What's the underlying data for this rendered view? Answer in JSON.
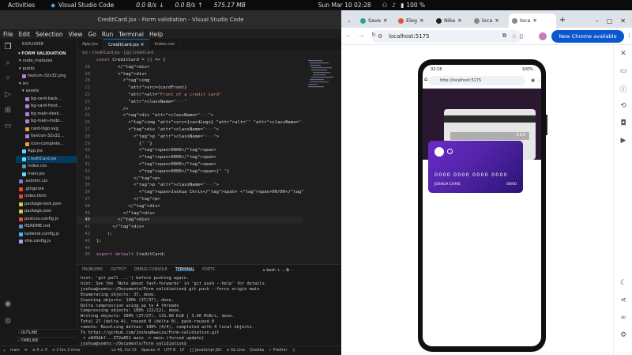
{
  "topbar": {
    "activities": "Activities",
    "app": "Visual Studio Code",
    "net_down": "0.0 B/s",
    "net_up": "0.0 B/s",
    "mem": "575.17 MB",
    "clock": "Sun Mar 10  02:28",
    "battery": "100 %"
  },
  "vscode": {
    "title": "CreditCard.jsx - Form validiation - Visual Studio Code",
    "menu": [
      "File",
      "Edit",
      "Selection",
      "View",
      "Go",
      "Run",
      "Terminal",
      "Help"
    ],
    "explorer_header": "EXPLORER",
    "project": "FORM VALIDIATION",
    "tree": [
      {
        "name": "node_modules",
        "kind": "folder",
        "indent": 1
      },
      {
        "name": "public",
        "kind": "folder",
        "indent": 1
      },
      {
        "name": "favicon-32x32.png",
        "kind": "file",
        "indent": 2,
        "color": "#b180d7"
      },
      {
        "name": "src",
        "kind": "folder",
        "indent": 1
      },
      {
        "name": "assets",
        "kind": "folder",
        "indent": 2
      },
      {
        "name": "bg-card-back...",
        "kind": "file",
        "indent": 3,
        "color": "#b180d7"
      },
      {
        "name": "bg-card-front...",
        "kind": "file",
        "indent": 3,
        "color": "#b180d7"
      },
      {
        "name": "bg-main-desk...",
        "kind": "file",
        "indent": 3,
        "color": "#b180d7"
      },
      {
        "name": "bg-main-mobi...",
        "kind": "file",
        "indent": 3,
        "color": "#b180d7"
      },
      {
        "name": "card-logo.svg",
        "kind": "file",
        "indent": 3,
        "color": "#e5a23c"
      },
      {
        "name": "favicon-32x32...",
        "kind": "file",
        "indent": 3,
        "color": "#b180d7"
      },
      {
        "name": "icon-complete...",
        "kind": "file",
        "indent": 3,
        "color": "#e5a23c"
      },
      {
        "name": "App.jsx",
        "kind": "file",
        "indent": 2,
        "color": "#61dafb"
      },
      {
        "name": "CreditCard.jsx",
        "kind": "file",
        "indent": 2,
        "color": "#61dafb",
        "selected": true
      },
      {
        "name": "index.css",
        "kind": "file",
        "indent": 2,
        "color": "#519aba"
      },
      {
        "name": "main.jsx",
        "kind": "file",
        "indent": 2,
        "color": "#61dafb"
      },
      {
        "name": ".eslintrc.cjs",
        "kind": "file",
        "indent": 1,
        "color": "#8a6fdc"
      },
      {
        "name": ".gitignore",
        "kind": "file",
        "indent": 1,
        "color": "#e44d26"
      },
      {
        "name": "index.html",
        "kind": "file",
        "indent": 1,
        "color": "#e44d26"
      },
      {
        "name": "package-lock.json",
        "kind": "file",
        "indent": 1,
        "color": "#cbcb41"
      },
      {
        "name": "package.json",
        "kind": "file",
        "indent": 1,
        "color": "#cbcb41"
      },
      {
        "name": "postcss.config.js",
        "kind": "file",
        "indent": 1,
        "color": "#e44d26"
      },
      {
        "name": "README.md",
        "kind": "file",
        "indent": 1,
        "color": "#519aba"
      },
      {
        "name": "tailwind.config.js",
        "kind": "file",
        "indent": 1,
        "color": "#38bdf8"
      },
      {
        "name": "vite.config.js",
        "kind": "file",
        "indent": 1,
        "color": "#bd93f9"
      }
    ],
    "outline": "OUTLINE",
    "timeline": "TIMELINE",
    "tabs": [
      {
        "label": "App.jsx",
        "active": false
      },
      {
        "label": "CreditCard.jsx",
        "active": true
      },
      {
        "label": "index.css",
        "active": false
      }
    ],
    "breadcrumb": "src › CreditCard.jsx › [@] CreditCard",
    "code": [
      {
        "n": "",
        "t": "const CreditCard = () => {"
      },
      {
        "n": "18",
        "t": "        </div>"
      },
      {
        "n": "19",
        "t": "        <div>"
      },
      {
        "n": "20",
        "t": "          <img"
      },
      {
        "n": "21",
        "t": "            src={cardFront}"
      },
      {
        "n": "22",
        "t": "            alt=\"Front of a credit card\""
      },
      {
        "n": "23",
        "t": "            className=\"···\""
      },
      {
        "n": "24",
        "t": "          />"
      },
      {
        "n": "25",
        "t": "          <div className=\"···\">"
      },
      {
        "n": "26",
        "t": "            <img src={cardLogo} alt=\"\" className=\"···\" />"
      },
      {
        "n": "27",
        "t": "            <div className=\"···\">"
      },
      {
        "n": "28",
        "t": "              <p className=\"···\">"
      },
      {
        "n": "29",
        "t": "                {\" \"}"
      },
      {
        "n": "30",
        "t": "                <span>0000</span>"
      },
      {
        "n": "31",
        "t": "                <span>0000</span>"
      },
      {
        "n": "32",
        "t": "                <span>0000</span>"
      },
      {
        "n": "33",
        "t": "                <span>0000</span>{\" \"}"
      },
      {
        "n": "34",
        "t": "              </p>"
      },
      {
        "n": "35",
        "t": "              <p className=\"···\">"
      },
      {
        "n": "36",
        "t": "                <span>Joshua Chris</span> <span>00/00</span>"
      },
      {
        "n": "37",
        "t": "              </p>"
      },
      {
        "n": "38",
        "t": "            </div>"
      },
      {
        "n": "39",
        "t": "          </div>"
      },
      {
        "n": "40",
        "t": "        </div>"
      },
      {
        "n": "41",
        "t": "      </div>"
      },
      {
        "n": "42",
        "t": "    );"
      },
      {
        "n": "43",
        "t": "};"
      },
      {
        "n": "44",
        "t": ""
      },
      {
        "n": "45",
        "t": "export default CreditCard;"
      }
    ],
    "current_line": "40",
    "panel_tabs": [
      "PROBLEMS",
      "OUTPUT",
      "DEBUG CONSOLE",
      "TERMINAL",
      "PORTS"
    ],
    "active_panel": "TERMINAL",
    "shell": "bash",
    "terminal": [
      "hint: 'git pull ...') before pushing again.",
      "hint: See the 'Note about fast-forwards' in 'git push --help' for details.",
      "joshua@somto:~/Documents/Form validiation$ git push --force origin main",
      "Enumerating objects: 37, done.",
      "Counting objects: 100% (37/37), done.",
      "Delta compression using up to 4 threads",
      "Compressing objects: 100% (22/22), done.",
      "Writing objects: 100% (27/27), 131.68 KiB | 3.66 MiB/s, done.",
      "Total 27 (delta 4), reused 0 (delta 0), pack-reused 0",
      "remote: Resolving deltas: 100% (4/4), completed with 4 local objects.",
      "To https://github.com/JoshuaNwaizu/Form-validiation.git",
      " + e043dbf...372a851 main -> main (forced update)",
      "joshua@somto:~/Documents/Form validiation$ "
    ],
    "status": {
      "branch": "main",
      "sync": "⟳",
      "problems": "⊗ 0 ⚠ 0",
      "time": "⊙ 2 hrs 3 mins",
      "position": "Ln 40, Col 13",
      "spaces": "Spaces: 4",
      "encoding": "UTF-8",
      "eol": "LF",
      "lang": "{} JavaScript JSX",
      "golive": "⊙ Go Live",
      "quokka": "Quokka",
      "prettier": "✓ Prettier"
    }
  },
  "chrome": {
    "tabs": [
      {
        "label": "Save",
        "color": "#2aa198"
      },
      {
        "label": "Eleg",
        "color": "#e5533d"
      },
      {
        "label": "Nike",
        "color": "#222222"
      },
      {
        "label": "loca",
        "color": "#888888"
      },
      {
        "label": "loca",
        "color": "#888888",
        "active": true
      }
    ],
    "url": "localhost:5175",
    "update_button": "New Chrome available",
    "phone": {
      "time": "02:18",
      "battery": "100%",
      "url": "http://localhost:5175",
      "card_back_cvc": "000",
      "card_number": "0000 0000 0000 0000",
      "card_name": "JOSHUA CHRIS",
      "card_expiry": "00/00"
    }
  }
}
